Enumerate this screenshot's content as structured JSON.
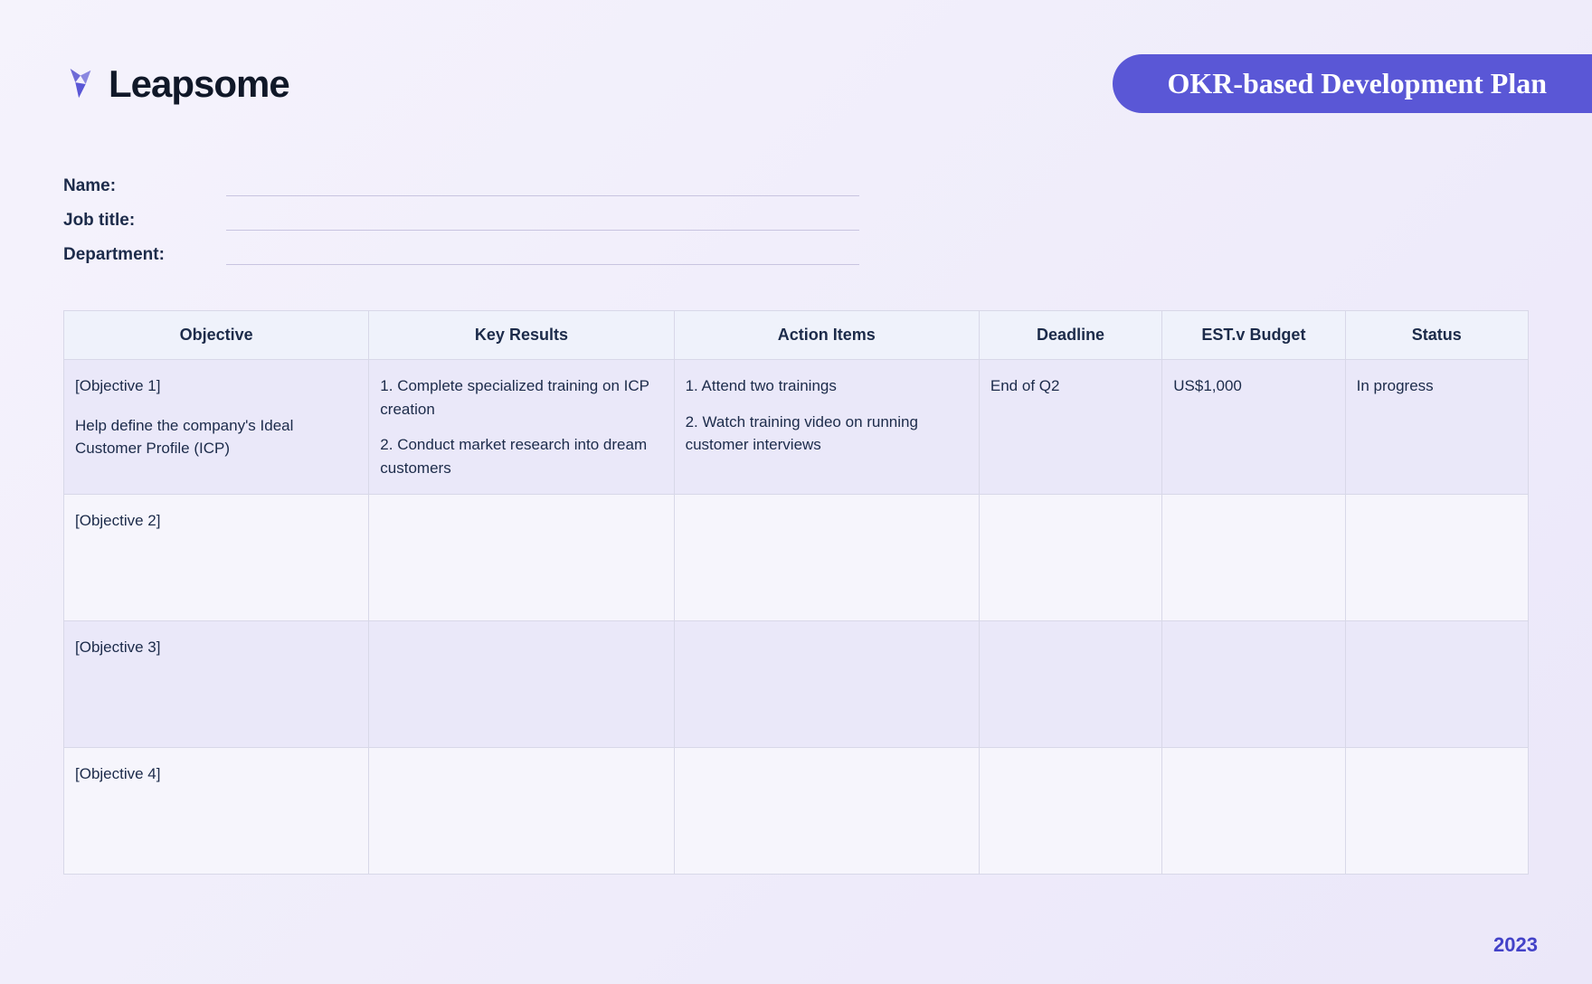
{
  "brand": {
    "name": "Leapsome"
  },
  "title": "OKR-based Development Plan",
  "fields": {
    "name_label": "Name:",
    "job_title_label": "Job title:",
    "department_label": "Department:"
  },
  "table": {
    "headers": {
      "objective": "Objective",
      "key_results": "Key Results",
      "action_items": "Action Items",
      "deadline": "Deadline",
      "budget": "EST.v Budget",
      "status": "Status"
    },
    "rows": [
      {
        "objective_title": "[Objective 1]",
        "objective_desc": "Help define the company's Ideal Customer Profile (ICP)",
        "kr1": "1. Complete specialized training on ICP creation",
        "kr2": "2. Conduct market research into dream customers",
        "ai1": "1. Attend two trainings",
        "ai2": "2. Watch training video on running customer interviews",
        "deadline": "End of Q2",
        "budget": "US$1,000",
        "status": "In progress"
      },
      {
        "objective_title": "[Objective 2]",
        "objective_desc": "",
        "kr1": "",
        "kr2": "",
        "ai1": "",
        "ai2": "",
        "deadline": "",
        "budget": "",
        "status": ""
      },
      {
        "objective_title": "[Objective 3]",
        "objective_desc": "",
        "kr1": "",
        "kr2": "",
        "ai1": "",
        "ai2": "",
        "deadline": "",
        "budget": "",
        "status": ""
      },
      {
        "objective_title": "[Objective 4]",
        "objective_desc": "",
        "kr1": "",
        "kr2": "",
        "ai1": "",
        "ai2": "",
        "deadline": "",
        "budget": "",
        "status": ""
      }
    ]
  },
  "footer": {
    "year": "2023"
  }
}
